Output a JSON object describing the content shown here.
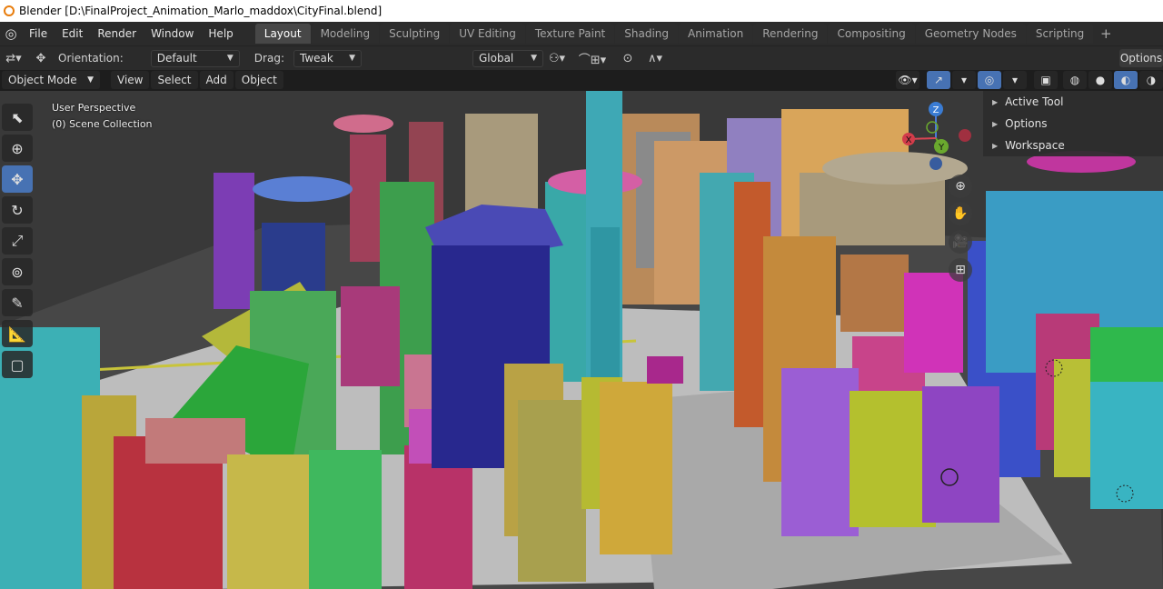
{
  "window": {
    "title": "Blender [D:\\FinalProject_Animation_Marlo_maddox\\CityFinal.blend]"
  },
  "menu": {
    "items": [
      "File",
      "Edit",
      "Render",
      "Window",
      "Help"
    ]
  },
  "workspaces": {
    "tabs": [
      "Layout",
      "Modeling",
      "Sculpting",
      "UV Editing",
      "Texture Paint",
      "Shading",
      "Animation",
      "Rendering",
      "Compositing",
      "Geometry Nodes",
      "Scripting"
    ],
    "active": "Layout"
  },
  "tool_header": {
    "orientation_label": "Orientation:",
    "orientation_value": "Default",
    "drag_label": "Drag:",
    "drag_value": "Tweak",
    "transform_orientation": "Global",
    "options_label": "Options"
  },
  "viewport_header": {
    "mode": "Object Mode",
    "menus": [
      "View",
      "Select",
      "Add",
      "Object"
    ]
  },
  "viewport": {
    "perspective": "User Perspective",
    "collection": "(0) Scene Collection"
  },
  "sidebar": {
    "sections": [
      "Active Tool",
      "Options",
      "Workspace"
    ]
  },
  "gizmo": {
    "x": "X",
    "y": "Y",
    "z": "Z"
  },
  "colors": {
    "accent": "#4772b3",
    "brand": "#e87d0d"
  }
}
